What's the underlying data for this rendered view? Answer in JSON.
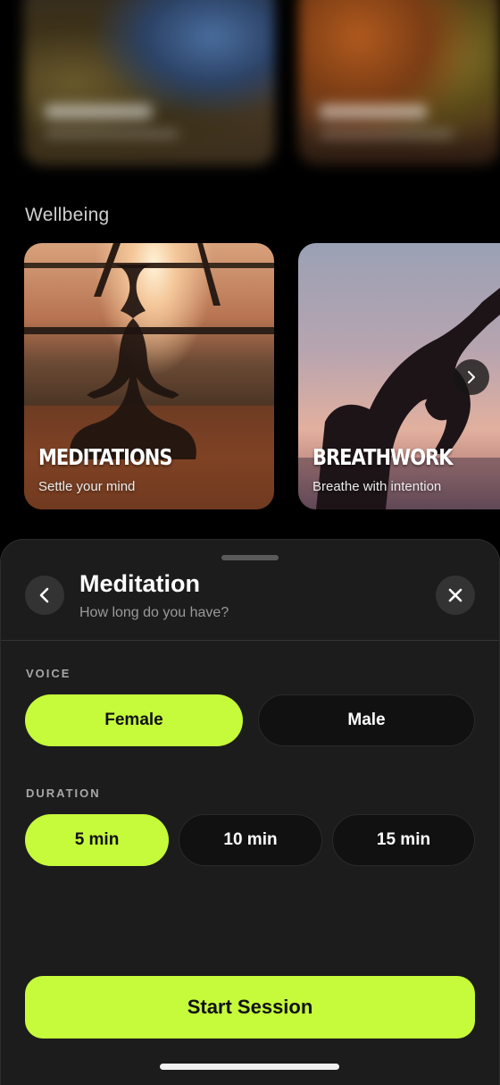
{
  "feed": {
    "top_cards": [
      {
        "id": "card-1"
      },
      {
        "id": "card-2"
      }
    ],
    "wellbeing": {
      "section_title": "Wellbeing",
      "cards": [
        {
          "title": "MEDITATIONS",
          "subtitle": "Settle your mind"
        },
        {
          "title": "BREATHWORK",
          "subtitle": "Breathe with intention"
        }
      ],
      "next_icon": "chevron-right-icon"
    }
  },
  "sheet": {
    "title": "Meditation",
    "subtitle": "How long do you have?",
    "back_icon": "chevron-left-icon",
    "close_icon": "close-icon",
    "voice": {
      "label": "VOICE",
      "options": [
        "Female",
        "Male"
      ],
      "selected": "Female"
    },
    "duration": {
      "label": "DURATION",
      "options": [
        "5 min",
        "10 min",
        "15 min"
      ],
      "selected": "5 min"
    },
    "start_label": "Start Session"
  },
  "colors": {
    "accent": "#c6fb3c",
    "sheet_bg": "#1c1c1c",
    "page_bg": "#000000"
  }
}
